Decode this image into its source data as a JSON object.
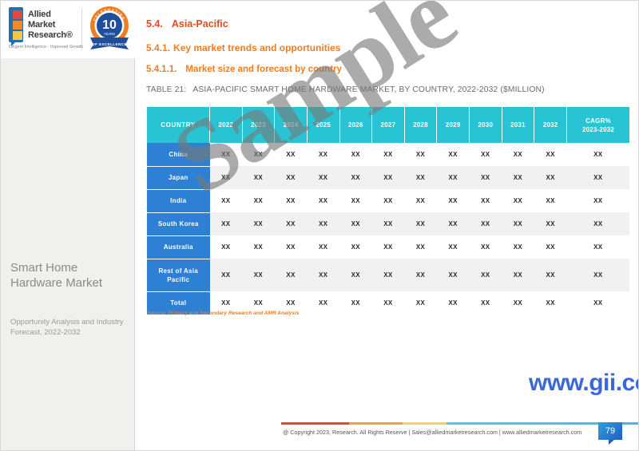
{
  "sidebar": {
    "logo": {
      "words": [
        "Allied",
        "Market",
        "Research®"
      ],
      "tagline": "Diligent Intelligence - Improved Growth"
    },
    "badge": {
      "top_text": "CELEBRATING",
      "number": "10",
      "years_text": "YEARS",
      "ribbon_text": "OF EXCELLENCE"
    },
    "report_title": "Smart Home Hardware Market",
    "report_subtitle": "Opportunity Analysis and Industry Forecast, 2022-2032"
  },
  "headings": {
    "h1_num": "5.4.",
    "h1_text": "Asia-Pacific",
    "h2_num": "5.4.1.",
    "h2_text": "Key market trends and opportunities",
    "h3_num": "5.4.1.1.",
    "h3_text": "Market size and forecast by country"
  },
  "table_caption": {
    "label": "TABLE 21:",
    "text": "ASIA-PACIFIC SMART HOME HARDWARE MARKET, BY COUNTRY, 2022-2032 ($MILLION)"
  },
  "table": {
    "columns": [
      "COUNTRY",
      "2022",
      "2023",
      "2024",
      "2025",
      "2026",
      "2027",
      "2028",
      "2029",
      "2030",
      "2031",
      "2032",
      "CAGR%"
    ],
    "cagr_subheader": "2023-2032",
    "rows": [
      {
        "label": "China",
        "values": [
          "XX",
          "XX",
          "XX",
          "XX",
          "XX",
          "XX",
          "XX",
          "XX",
          "XX",
          "XX",
          "XX",
          "XX"
        ]
      },
      {
        "label": "Japan",
        "values": [
          "XX",
          "XX",
          "XX",
          "XX",
          "XX",
          "XX",
          "XX",
          "XX",
          "XX",
          "XX",
          "XX",
          "XX"
        ]
      },
      {
        "label": "India",
        "values": [
          "XX",
          "XX",
          "XX",
          "XX",
          "XX",
          "XX",
          "XX",
          "XX",
          "XX",
          "XX",
          "XX",
          "XX"
        ]
      },
      {
        "label": "South Korea",
        "values": [
          "XX",
          "XX",
          "XX",
          "XX",
          "XX",
          "XX",
          "XX",
          "XX",
          "XX",
          "XX",
          "XX",
          "XX"
        ]
      },
      {
        "label": "Australia",
        "values": [
          "XX",
          "XX",
          "XX",
          "XX",
          "XX",
          "XX",
          "XX",
          "XX",
          "XX",
          "XX",
          "XX",
          "XX"
        ]
      },
      {
        "label": "Rest of Asia Pacific",
        "values": [
          "XX",
          "XX",
          "XX",
          "XX",
          "XX",
          "XX",
          "XX",
          "XX",
          "XX",
          "XX",
          "XX",
          "XX"
        ]
      },
      {
        "label": "Total",
        "values": [
          "XX",
          "XX",
          "XX",
          "XX",
          "XX",
          "XX",
          "XX",
          "XX",
          "XX",
          "XX",
          "XX",
          "XX"
        ]
      }
    ],
    "header_color": "#29c4d4",
    "rowlabel_color": "#2e80d4",
    "stripe_color": "#f1f1f1"
  },
  "source_note": "Source: Primary and Secondary Research and AMR Analysis",
  "watermarks": {
    "sample": "Sample",
    "site": "www.gii.co.jp",
    "site_color": "#3b68d8"
  },
  "footer": {
    "text": "@ Copyright 2023, Research. All Rights Reserve | Sales@alliedmarketresearch.com | www.alliedmarketresearch.com",
    "page_number": "79",
    "bar_colors": [
      "#ee4423",
      "#f4a03c",
      "#fbd34a",
      "#3fd0ee",
      "#4aa8e8"
    ]
  }
}
